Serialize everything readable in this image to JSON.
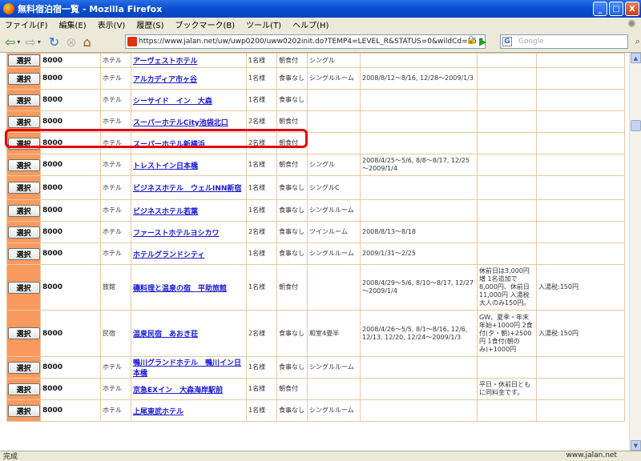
{
  "window": {
    "title": "無料宿泊宿一覧 - Mozilla Firefox",
    "buttons": [
      "_",
      "□",
      "X"
    ]
  },
  "menu": [
    "ファイル(F)",
    "編集(E)",
    "表示(V)",
    "履歴(S)",
    "ブックマーク(B)",
    "ツール(T)",
    "ヘルプ(H)"
  ],
  "url": "https://www.jalan.net/uw/uwp0200/uww0202init.do?TEMP4=LEVEL_R&STATUS=0&wildCd=15",
  "search_placeholder": "Google",
  "status": {
    "left": "完成",
    "right": "www.jalan.net"
  },
  "select_label": "選択",
  "rows": [
    {
      "price": "8000",
      "type": "ホテル",
      "name": "アーヴェストホテル",
      "people": "1名様",
      "meal": "朝食付",
      "room": "シングル",
      "period": "",
      "note": "",
      "tax": ""
    },
    {
      "price": "8000",
      "type": "ホテル",
      "name": "アルカディア市ヶ谷",
      "people": "1名様",
      "meal": "食事なし",
      "room": "シングルルーム",
      "period": "2008/8/12～8/16, 12/28～2009/1/3",
      "note": "",
      "tax": ""
    },
    {
      "price": "8000",
      "type": "ホテル",
      "name": "シーサイド　イン　大森",
      "people": "1名様",
      "meal": "食事なし",
      "room": "",
      "period": "",
      "note": "",
      "tax": ""
    },
    {
      "price": "8000",
      "type": "ホテル",
      "name": "スーパーホテルCity池袋北口",
      "people": "2名様",
      "meal": "朝食付",
      "room": "",
      "period": "",
      "note": "",
      "tax": ""
    },
    {
      "price": "8000",
      "type": "ホテル",
      "name": "スーパーホテル新横浜",
      "people": "2名様",
      "meal": "朝食付",
      "room": "",
      "period": "",
      "note": "",
      "tax": ""
    },
    {
      "price": "8000",
      "type": "ホテル",
      "name": "トレストイン日本橋",
      "people": "1名様",
      "meal": "朝食付",
      "room": "シングル",
      "period": "2008/4/25～5/6, 8/8～8/17, 12/25～2009/1/4",
      "note": "",
      "tax": ""
    },
    {
      "price": "8000",
      "type": "ホテル",
      "name": "ビジネスホテル　ウェルINN新宿",
      "people": "1名様",
      "meal": "食事なし",
      "room": "シングルC",
      "period": "",
      "note": "",
      "tax": ""
    },
    {
      "price": "8000",
      "type": "ホテル",
      "name": "ビジネスホテル若葉",
      "people": "1名様",
      "meal": "食事なし",
      "room": "シングルルーム",
      "period": "",
      "note": "",
      "tax": ""
    },
    {
      "price": "8000",
      "type": "ホテル",
      "name": "ファーストホテルヨシカワ",
      "people": "2名様",
      "meal": "食事なし",
      "room": "ツインルーム",
      "period": "2008/8/13～8/18",
      "note": "",
      "tax": ""
    },
    {
      "price": "8000",
      "type": "ホテル",
      "name": "ホテルグランドシティ",
      "people": "1名様",
      "meal": "食事なし",
      "room": "シングルルーム",
      "period": "2009/1/31～2/25",
      "note": "",
      "tax": ""
    },
    {
      "price": "8000",
      "type": "旅館",
      "name": "磯料理と温泉の宿　平助旅館",
      "people": "1名様",
      "meal": "朝食付",
      "room": "",
      "period": "2008/4/29～5/6, 8/10～8/17, 12/27～2009/1/4",
      "note": "休前日は3,000円増 1名追加で8,000円、休前日11,000円 入湯税大人のみ150円。",
      "tax": "入湯税:150円"
    },
    {
      "price": "8000",
      "type": "民宿",
      "name": "温泉民宿　あおき荘",
      "people": "2名様",
      "meal": "食事なし",
      "room": "和室4畳半",
      "period": "2008/4/26～5/5, 8/1～8/16, 12/6, 12/13, 12/20, 12/24～2009/1/3",
      "note": "GW、夏季・年末年始+1000円 2食付(夕・朝)+2500円 1食付(朝のみ)+1000円",
      "tax": "入湯税:150円"
    },
    {
      "price": "8000",
      "type": "ホテル",
      "name": "鴨川グランドホテル　鴨川イン日本橋",
      "people": "1名様",
      "meal": "食事なし",
      "room": "シングルルーム",
      "period": "",
      "note": "",
      "tax": ""
    },
    {
      "price": "8000",
      "type": "ホテル",
      "name": "京急EXイン　大森海岸駅前",
      "people": "1名様",
      "meal": "朝食付",
      "room": "",
      "period": "",
      "note": "平日・休前日ともに同料金です。",
      "tax": ""
    },
    {
      "price": "8000",
      "type": "ホテル",
      "name": "上尾東武ホテル",
      "people": "1名様",
      "meal": "食事なし",
      "room": "シングルルーム",
      "period": "",
      "note": "",
      "tax": ""
    }
  ]
}
